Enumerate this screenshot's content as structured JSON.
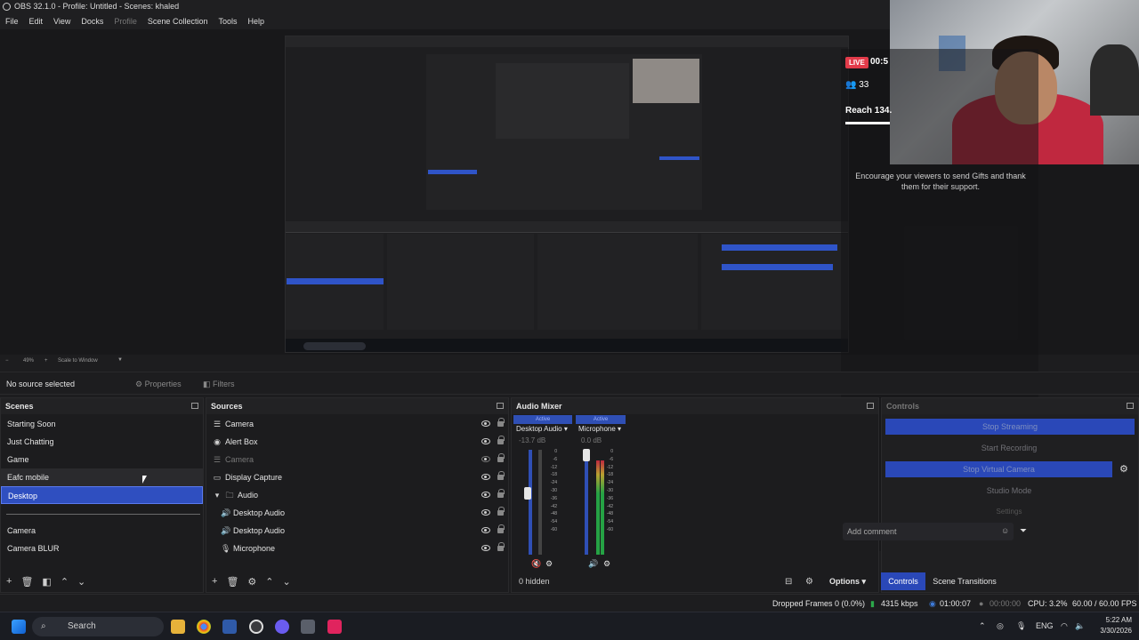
{
  "window": {
    "title": "OBS 32.1.0 - Profile: Untitled - Scenes: khaled"
  },
  "menu": [
    "File",
    "Edit",
    "View",
    "Docks",
    "Profile",
    "Scene Collection",
    "Tools",
    "Help"
  ],
  "preview": {
    "live_label": "LIVE",
    "live_time": "00:5",
    "viewer_count": "33",
    "reach_label": "Reach 134.",
    "gift_message": "Encourage your viewers to send Gifts and thank them for their support."
  },
  "scale": {
    "zoom": "49%",
    "mode": "Scale to Window"
  },
  "source_toolbar": {
    "no_source": "No source selected",
    "properties": "Properties",
    "filters": "Filters"
  },
  "scenes": {
    "title": "Scenes",
    "items": [
      "Starting Soon",
      "Just Chatting",
      "Game",
      "Eafc mobile",
      "Desktop",
      "Camera",
      "Camera BLUR"
    ],
    "selected": "Desktop"
  },
  "sources": {
    "title": "Sources",
    "items": [
      {
        "label": "Camera",
        "icon": "list-icon"
      },
      {
        "label": "Alert Box",
        "icon": "globe-icon"
      },
      {
        "label": "Camera",
        "icon": "list-icon"
      },
      {
        "label": "Display Capture",
        "icon": "monitor-icon"
      },
      {
        "label": "Audio",
        "icon": "folder-icon"
      },
      {
        "label": "Desktop Audio",
        "icon": "speaker-icon"
      },
      {
        "label": "Desktop Audio",
        "icon": "speaker-icon"
      },
      {
        "label": "Microphone",
        "icon": "microphone-icon"
      }
    ]
  },
  "mixer": {
    "title": "Audio Mixer",
    "channels": [
      {
        "status": "Active",
        "name": "Desktop Audio",
        "db": "-13.7 dB",
        "level": 0.0,
        "fader": 0.6
      },
      {
        "status": "Active",
        "name": "Microphone",
        "db": "0.0 dB",
        "level": 0.85,
        "fader": 1.0
      }
    ],
    "scale": [
      "0",
      "-6",
      "-12",
      "-18",
      "-24",
      "-30",
      "-36",
      "-42",
      "-48",
      "-54",
      "-60"
    ],
    "hidden": "0 hidden",
    "options": "Options"
  },
  "controls": {
    "title": "Controls",
    "buttons": [
      "Stop Streaming",
      "Start Recording",
      "Stop Virtual Camera",
      "Studio Mode",
      "Settings"
    ],
    "comment_placeholder": "Add comment",
    "tabs": [
      "Controls",
      "Scene Transitions"
    ]
  },
  "status": {
    "dropped": "Dropped Frames 0 (0.0%)",
    "bitrate": "4315 kbps",
    "stream_time": "01:00:07",
    "rec_time": "00:00:00",
    "cpu": "CPU: 3.2%",
    "fps": "60.00 / 60.00 FPS"
  },
  "taskbar": {
    "search": "Search",
    "lang": "ENG",
    "time": "5:22 AM",
    "date": "3/30/2026"
  }
}
